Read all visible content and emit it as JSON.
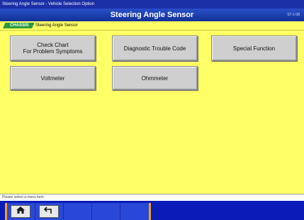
{
  "window": {
    "title": "Steering Angle Sensor - Vehicle Selection Option"
  },
  "header": {
    "title": "Steering Angle Sensor",
    "code": "ST-1-08"
  },
  "breadcrumb": {
    "tab_label": "CHASSIS",
    "current": "Steering Angle Sensor"
  },
  "menu": {
    "check_chart": "Check Chart\nFor Problem Symptoms",
    "dtc": "Diagnostic Trouble Code",
    "special_function": "Special Function",
    "voltmeter": "Voltmeter",
    "ohmmeter": "Ohmmeter"
  },
  "status": {
    "text": "Please select a menu item."
  },
  "toolbar": {
    "buttons": [
      {
        "icon": "home-icon"
      },
      {
        "icon": "back-icon"
      }
    ]
  }
}
